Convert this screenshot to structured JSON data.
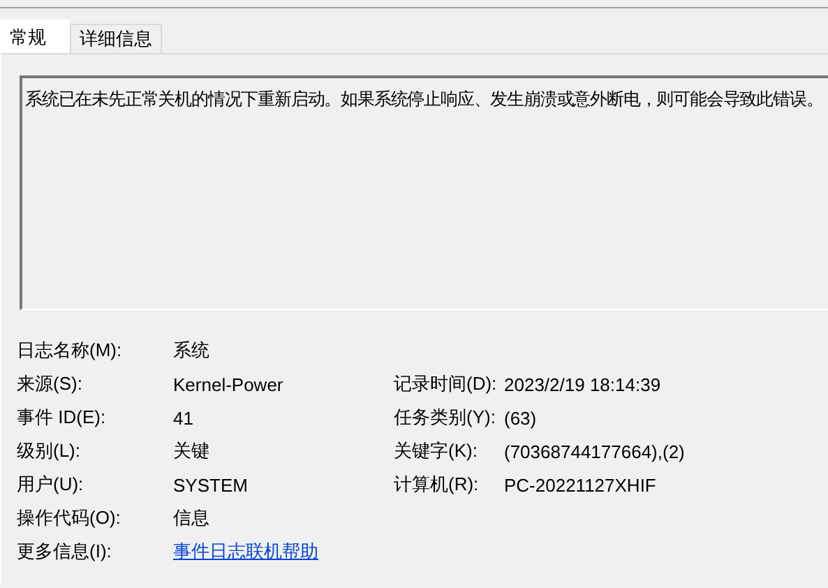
{
  "tabs": [
    {
      "label": "常规",
      "selected": true
    },
    {
      "label": "详细信息",
      "selected": false
    }
  ],
  "description": "系统已在未先正常关机的情况下重新启动。如果系统停止响应、发生崩溃或意外断电，则可能会导致此错误。",
  "rows": [
    {
      "fields": [
        {
          "label": "日志名称(M):",
          "value": "系统",
          "kind": "text"
        }
      ]
    },
    {
      "fields": [
        {
          "label": "来源(S):",
          "value": "Kernel-Power",
          "kind": "text"
        },
        {
          "label": "记录时间(D):",
          "value": "2023/2/19 18:14:39",
          "kind": "text"
        }
      ]
    },
    {
      "fields": [
        {
          "label": "事件 ID(E):",
          "value": "41",
          "kind": "text"
        },
        {
          "label": "任务类别(Y):",
          "value": "(63)",
          "kind": "text"
        }
      ]
    },
    {
      "fields": [
        {
          "label": "级别(L):",
          "value": "关键",
          "kind": "text"
        },
        {
          "label": "关键字(K):",
          "value": "(70368744177664),(2)",
          "kind": "text"
        }
      ]
    },
    {
      "fields": [
        {
          "label": "用户(U):",
          "value": "SYSTEM",
          "kind": "text"
        },
        {
          "label": "计算机(R):",
          "value": "PC-20221127XHIF",
          "kind": "text"
        }
      ]
    },
    {
      "fields": [
        {
          "label": "操作代码(O):",
          "value": "信息",
          "kind": "text"
        }
      ]
    },
    {
      "fields": [
        {
          "label": "更多信息(I):",
          "value": "事件日志联机帮助",
          "kind": "link"
        }
      ]
    }
  ]
}
